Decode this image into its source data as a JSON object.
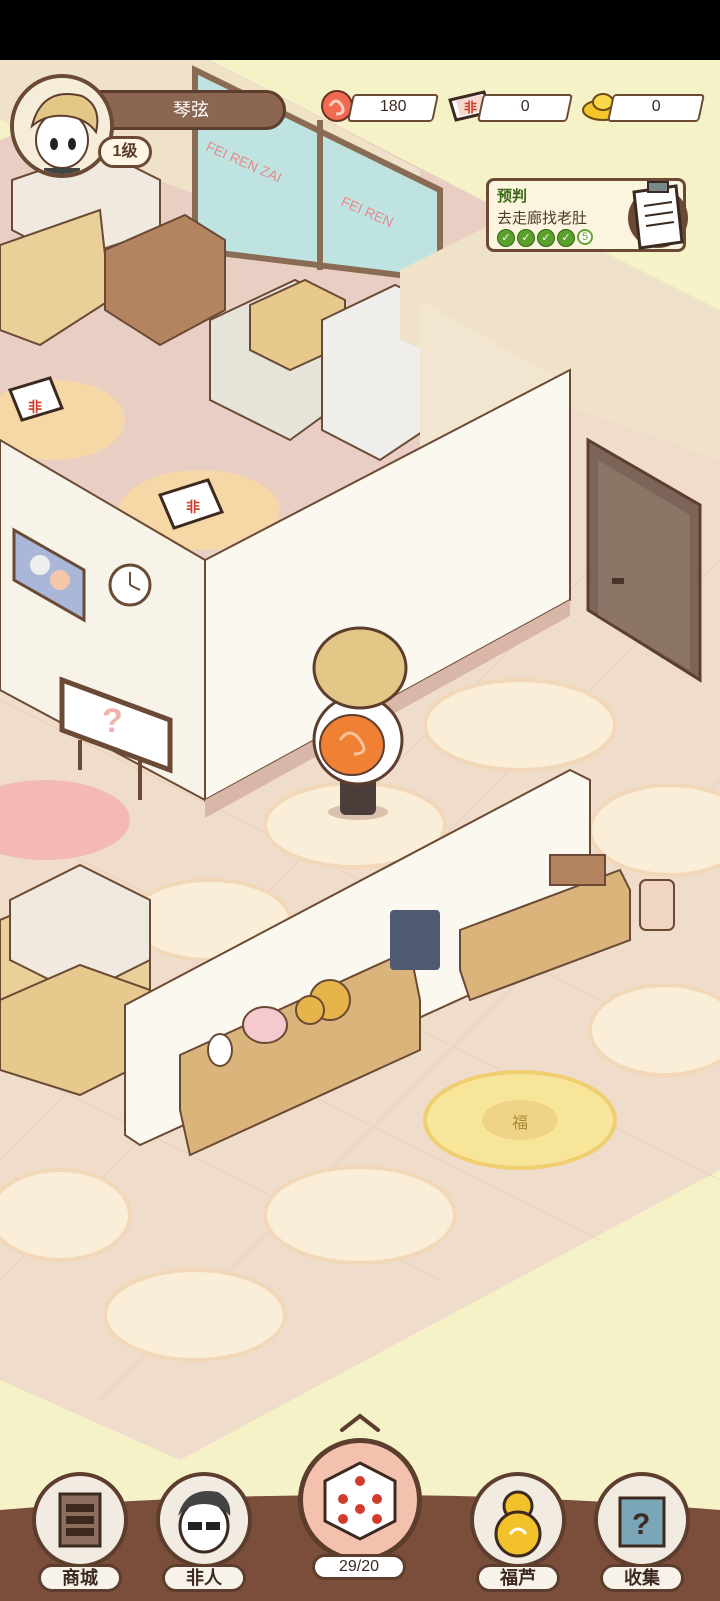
{
  "player": {
    "name": "琴弦",
    "level": "1级"
  },
  "resources": [
    {
      "icon": "cloud-token-icon",
      "value": "180"
    },
    {
      "icon": "ticket-icon",
      "value": "0",
      "label": "非"
    },
    {
      "icon": "gold-ingot-icon",
      "value": "0"
    }
  ],
  "task": {
    "title": "预判",
    "desc": "去走廊找老肚",
    "count": "5"
  },
  "scene": {
    "window_sign_1": "FEI REN ZAI",
    "window_sign_2": "FEI REN",
    "ticket_mark": "非",
    "bag_mark": "福"
  },
  "nav": {
    "shop": "商城",
    "nonhuman": "非人",
    "dice_count": "29/20",
    "gourd": "福芦",
    "collect": "收集"
  },
  "colors": {
    "wall": "#f7f3e8",
    "floor": "#f1dccb",
    "dark_outline": "#5d3e2e",
    "accent_green": "#5aa02c"
  }
}
